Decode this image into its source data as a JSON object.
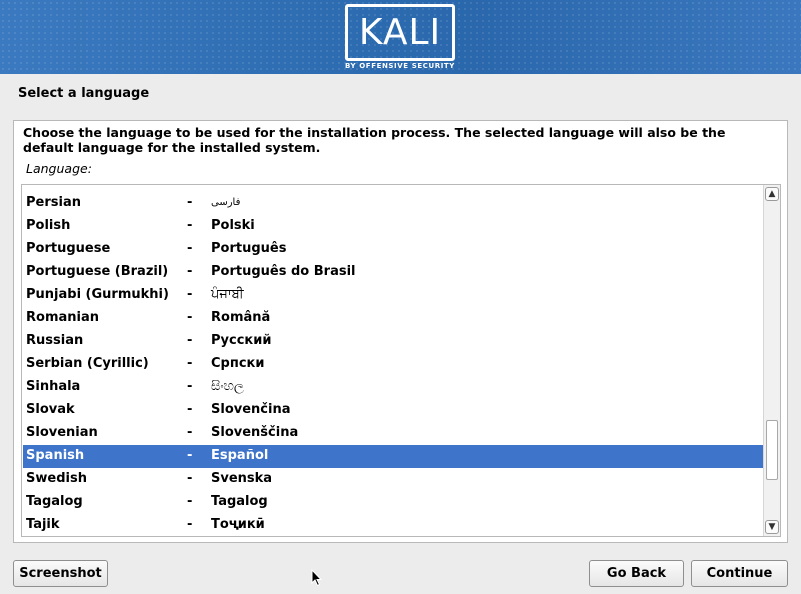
{
  "banner": {
    "logo_text": "KALI",
    "logo_subtitle": "BY OFFENSIVE SECURITY"
  },
  "step_title": "Select a language",
  "description": "Choose the language to be used for the installation process. The selected language will also be the default language for the installed system.",
  "field_label": "Language:",
  "languages": [
    {
      "name": "Persian",
      "dash": "-",
      "native": "فارسی"
    },
    {
      "name": "Polish",
      "dash": "-",
      "native": "Polski"
    },
    {
      "name": "Portuguese",
      "dash": "-",
      "native": "Português"
    },
    {
      "name": "Portuguese (Brazil)",
      "dash": "-",
      "native": "Português do Brasil"
    },
    {
      "name": "Punjabi (Gurmukhi)",
      "dash": "-",
      "native": "ਪੰਜਾਬੀ"
    },
    {
      "name": "Romanian",
      "dash": "-",
      "native": "Română"
    },
    {
      "name": "Russian",
      "dash": "-",
      "native": "Русский"
    },
    {
      "name": "Serbian (Cyrillic)",
      "dash": "-",
      "native": "Српски"
    },
    {
      "name": "Sinhala",
      "dash": "-",
      "native": "සිංහල"
    },
    {
      "name": "Slovak",
      "dash": "-",
      "native": "Slovenčina"
    },
    {
      "name": "Slovenian",
      "dash": "-",
      "native": "Slovenščina"
    },
    {
      "name": "Spanish",
      "dash": "-",
      "native": "Español"
    },
    {
      "name": "Swedish",
      "dash": "-",
      "native": "Svenska"
    },
    {
      "name": "Tagalog",
      "dash": "-",
      "native": "Tagalog"
    },
    {
      "name": "Tajik",
      "dash": "-",
      "native": "Тоҷикӣ"
    }
  ],
  "selected_language": "Spanish",
  "buttons": {
    "screenshot": "Screenshot",
    "go_back": "Go Back",
    "continue": "Continue"
  },
  "colors": {
    "banner": "#2f6eb3",
    "selection": "#3e74c9"
  },
  "icons": {
    "scroll_up": "triangle-up",
    "scroll_down": "triangle-down",
    "cursor": "mouse-pointer"
  }
}
